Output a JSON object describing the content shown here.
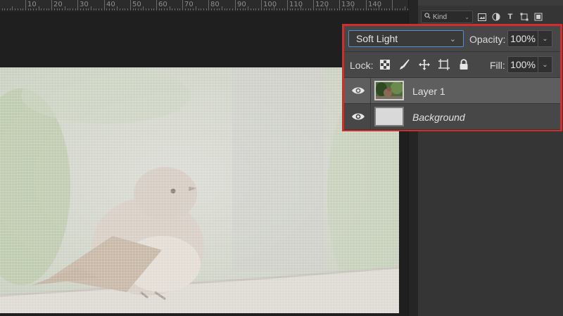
{
  "ruler": {
    "labels": [
      "10",
      "20",
      "30",
      "40",
      "50",
      "60",
      "70",
      "80",
      "90",
      "100",
      "110",
      "120",
      "130",
      "140"
    ]
  },
  "filter": {
    "kind_label": "Kind",
    "kind_icon": "search-icon"
  },
  "layers_panel": {
    "blend_mode": "Soft Light",
    "opacity_label": "Opacity:",
    "opacity_value": "100%",
    "lock_label": "Lock:",
    "fill_label": "Fill:",
    "fill_value": "100%",
    "layers": [
      {
        "name": "Layer 1",
        "selected": true,
        "visible": true,
        "italic": false
      },
      {
        "name": "Background",
        "selected": false,
        "visible": true,
        "italic": true
      }
    ]
  },
  "colors": {
    "highlight_border": "#d42b2b",
    "blend_focus": "#4f8fd6"
  }
}
